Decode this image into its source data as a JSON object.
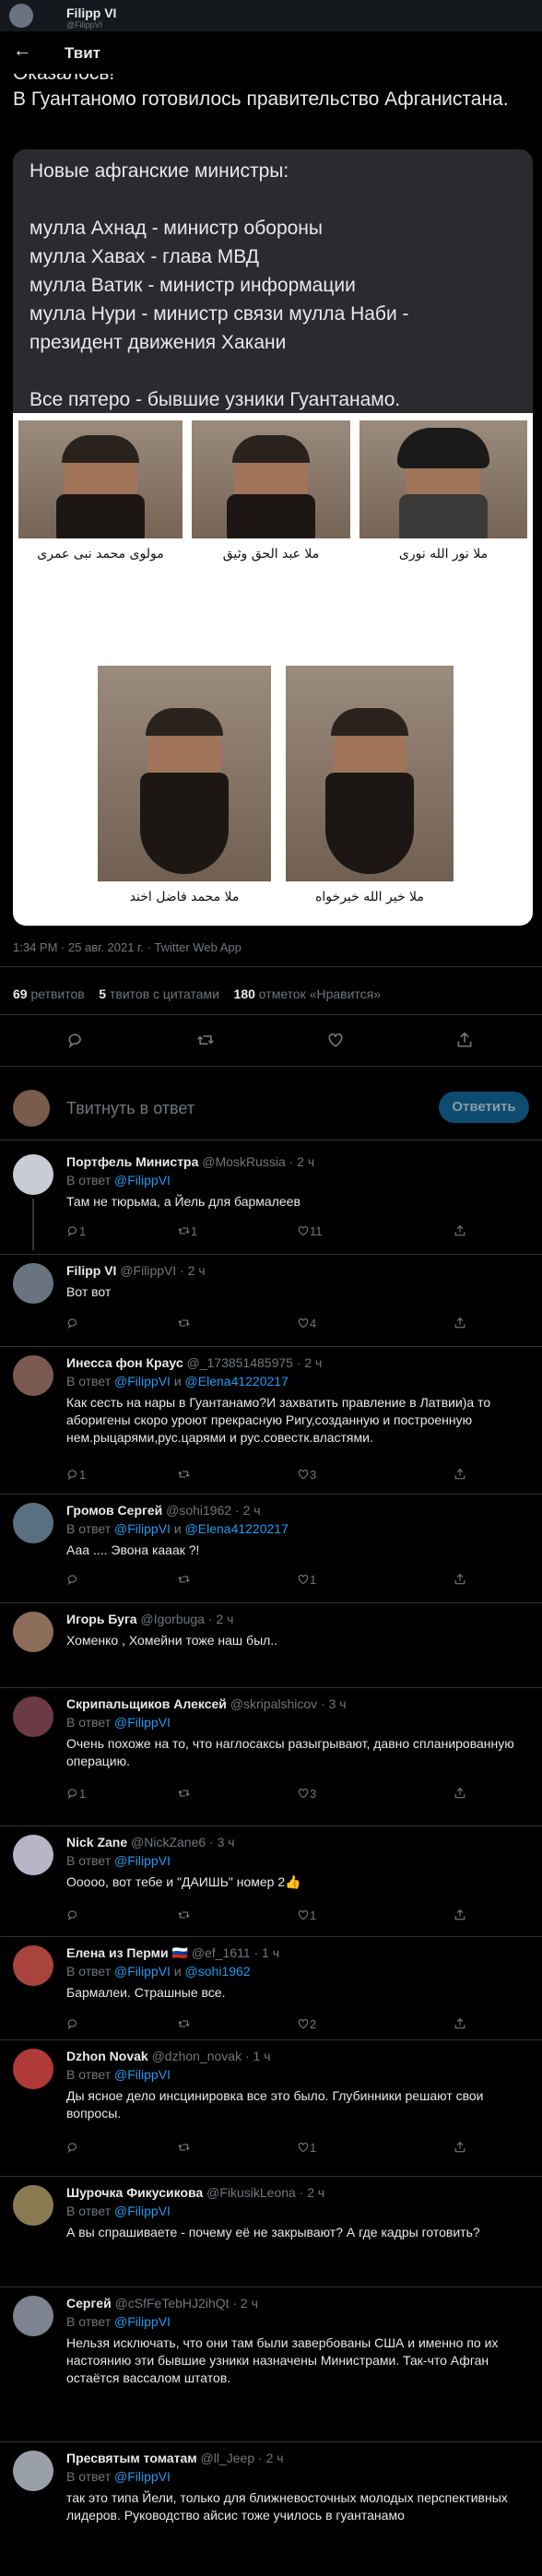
{
  "window": {
    "name": "Filipp VI",
    "sub": "@FilippVI"
  },
  "header": {
    "back_icon": "arrow-left-icon",
    "title": "Твит"
  },
  "tweet": {
    "cut_text": "Оказалось!",
    "text": "В Гуантаномо готовилось правительство Афганистана.",
    "card_lines": [
      "Новые афганские министры:",
      "",
      "мулла Ахнад - министр обороны",
      "мулла Хавах - глава МВД",
      "мулла Ватик - министр информации",
      "мулла Нури - министр связи мулла Наби -",
      "президент движения Хакани",
      "",
      "Все пятеро - бывшие узники Гуантанамо."
    ],
    "photo_captions": [
      "مولوی محمد نبی عمری",
      "ملا عبد الحق وثیق",
      "ملا نور الله نوری",
      "ملا محمد فاضل اخند",
      "ملا خیر الله خیرخواه"
    ],
    "meta": "1:34 PM · 25 авг. 2021 г. · Twitter Web App",
    "stats": {
      "retweets_n": "69",
      "retweets_l": "ретвитов",
      "quotes_n": "5",
      "quotes_l": "твитов с цитатами",
      "likes_n": "180",
      "likes_l": "отметок «Нравится»"
    }
  },
  "reply_box": {
    "placeholder": "Твитнуть в ответ",
    "button": "Ответить"
  },
  "replies": [
    {
      "name": "Портфель Министра",
      "handle": "@MoskRussia · 2 ч",
      "to": "@FilippVI",
      "to2": "",
      "text": "Там не тюрьма, а Йель для бармалеев",
      "reply_count": "1",
      "rt_count": "1",
      "like_count": "11",
      "avatar_color": "#c9ccd4"
    },
    {
      "name": "Filipp VI",
      "handle": "@FilippVI · 2 ч",
      "to": "",
      "to2": "",
      "text": "Вот вот",
      "reply_count": "",
      "rt_count": "",
      "like_count": "4",
      "avatar_color": "#6a7480"
    },
    {
      "name": "Инесса фон Краус",
      "handle": "@_173851485975 · 2 ч",
      "to": "@FilippVI",
      "to2": "@Elena41220217",
      "text": "Как сесть на нары в Гуантанамо?И захватить правление в Латвии)а то аборигены скоро уроют прекрасную Ригу,созданную и построенную нем.рыцарями,рус.царями и рус.совестк.властями.",
      "reply_count": "1",
      "rt_count": "",
      "like_count": "3",
      "avatar_color": "#7b5a52"
    },
    {
      "name": "Громов Сергей",
      "handle": "@sohi1962 · 2 ч",
      "to": "@FilippVI",
      "to2": "@Elena41220217",
      "text": "Ааа .... Эвона кааак ?!",
      "reply_count": "",
      "rt_count": "",
      "like_count": "1",
      "avatar_color": "#5a7080"
    },
    {
      "name": "Игорь Буга",
      "handle": "@Igorbuga · 2 ч",
      "to": "",
      "to2": "",
      "text": "Хоменко , Хомейни тоже наш был..",
      "reply_count": "",
      "rt_count": "",
      "like_count": "",
      "avatar_color": "#8c6d5a"
    },
    {
      "name": "Скрипальщиков Алексей",
      "handle": "@skripalshicov · 3 ч",
      "to": "@FilippVI",
      "to2": "",
      "text": "Очень похоже на то, что наглосаксы разыгрывают, давно спланированную операцию.",
      "reply_count": "1",
      "rt_count": "",
      "like_count": "3",
      "avatar_color": "#6a3a46"
    },
    {
      "name": "Nick Zane",
      "handle": "@NickZane6 · 3 ч",
      "to": "@FilippVI",
      "to2": "",
      "text": "Ооооо, вот тебе и \"ДАИШЬ\" номер 2👍",
      "reply_count": "",
      "rt_count": "",
      "like_count": "1",
      "avatar_color": "#b9b4c6"
    },
    {
      "name": "Елена из Перми 🇷🇺",
      "handle": "@ef_1611 · 1 ч",
      "to": "@FilippVI",
      "to2": "@sohi1962",
      "text": "Бармалеи. Страшные все.",
      "reply_count": "",
      "rt_count": "",
      "like_count": "2",
      "avatar_color": "#a8433d"
    },
    {
      "name": "Dzhon Novak",
      "handle": "@dzhon_novak · 1 ч",
      "to": "@FilippVI",
      "to2": "",
      "text": "Ды ясное дело инсцинировка все это было. Глубинники решают свои вопросы.",
      "reply_count": "",
      "rt_count": "",
      "like_count": "1",
      "avatar_color": "#b03a37"
    },
    {
      "name": "Шурочка Фикусикова",
      "handle": "@FikusikLeona · 2 ч",
      "to": "@FilippVI",
      "to2": "",
      "text": "А вы спрашиваете - почему её не закрывают? А где кадры готовить?",
      "reply_count": "",
      "rt_count": "",
      "like_count": "",
      "avatar_color": "#8a7a52"
    },
    {
      "name": "Сергей",
      "handle": "@cSfFeTebHJ2ihQt · 2 ч",
      "to": "@FilippVI",
      "to2": "",
      "text": "Нельзя исключать, что они там были завербованы США и именно по их настоянию эти бывшие узники назначены Министрами. Так-что Афган остаётся вассалом штатов.",
      "reply_count": "",
      "rt_count": "",
      "like_count": "",
      "avatar_color": "#7d8390"
    },
    {
      "name": "Пресвятым томатам",
      "handle": "@ll_Jeep · 2 ч",
      "to": "@FilippVI",
      "to2": "",
      "text": "так это типа Йели, только для ближневосточных молодых перспективных лидеров. Руководство айсис тоже училось в гуантанамо",
      "reply_count": "",
      "rt_count": "",
      "like_count": "",
      "avatar_color": "#9aa0aa"
    }
  ],
  "labels": {
    "reply_to_prefix": "В ответ",
    "and": "и"
  },
  "icons": {
    "reply": "reply-icon",
    "retweet": "retweet-icon",
    "like": "heart-icon",
    "share": "share-icon"
  }
}
